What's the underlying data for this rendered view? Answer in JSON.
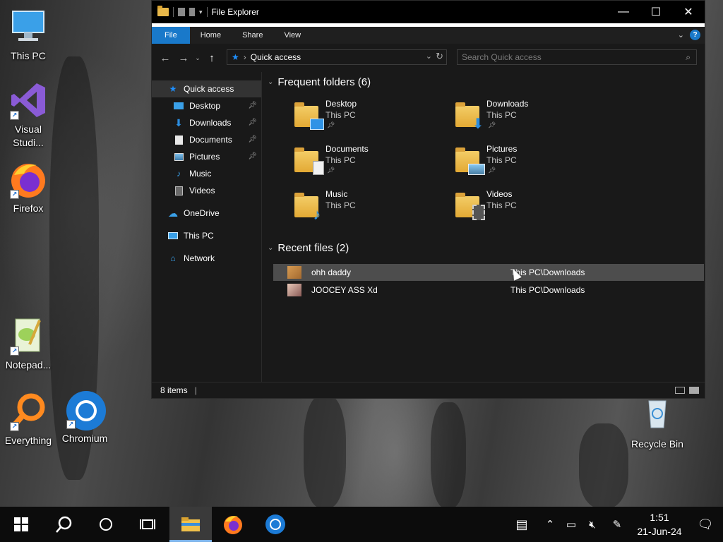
{
  "desktop": {
    "icons": [
      {
        "label": "This PC"
      },
      {
        "label": "Visual Studi..."
      },
      {
        "label": "Firefox"
      },
      {
        "label": "Notepad..."
      },
      {
        "label": "Everything"
      },
      {
        "label": "Chromium"
      },
      {
        "label": "Recycle Bin"
      }
    ]
  },
  "window": {
    "title": "File Explorer",
    "ribbon_tabs": [
      "File",
      "Home",
      "Share",
      "View"
    ],
    "address": {
      "path": "Quick access"
    },
    "search": {
      "placeholder": "Search Quick access"
    },
    "nav": {
      "quick_access": "Quick access",
      "items": [
        "Desktop",
        "Downloads",
        "Documents",
        "Pictures",
        "Music",
        "Videos"
      ],
      "onedrive": "OneDrive",
      "this_pc": "This PC",
      "network": "Network"
    },
    "frequent": {
      "header": "Frequent folders (6)",
      "folders": [
        {
          "name": "Desktop",
          "location": "This PC"
        },
        {
          "name": "Downloads",
          "location": "This PC"
        },
        {
          "name": "Documents",
          "location": "This PC"
        },
        {
          "name": "Pictures",
          "location": "This PC"
        },
        {
          "name": "Music",
          "location": "This PC"
        },
        {
          "name": "Videos",
          "location": "This PC"
        }
      ]
    },
    "recent": {
      "header": "Recent files (2)",
      "files": [
        {
          "name": "ohh daddy",
          "location": "This PC\\Downloads"
        },
        {
          "name": "JOOCEY ASS Xd",
          "location": "This PC\\Downloads"
        }
      ]
    },
    "status": {
      "items": "8 items"
    }
  },
  "taskbar": {
    "clock_time": "1:51",
    "clock_date": "21-Jun-24"
  },
  "colors": {
    "accent": "#1979ca",
    "window_bg": "#191919",
    "selected_row": "#4d4d4d",
    "taskbar_bg": "#0c0c0c",
    "folder_yellow": "#e8b84a"
  }
}
